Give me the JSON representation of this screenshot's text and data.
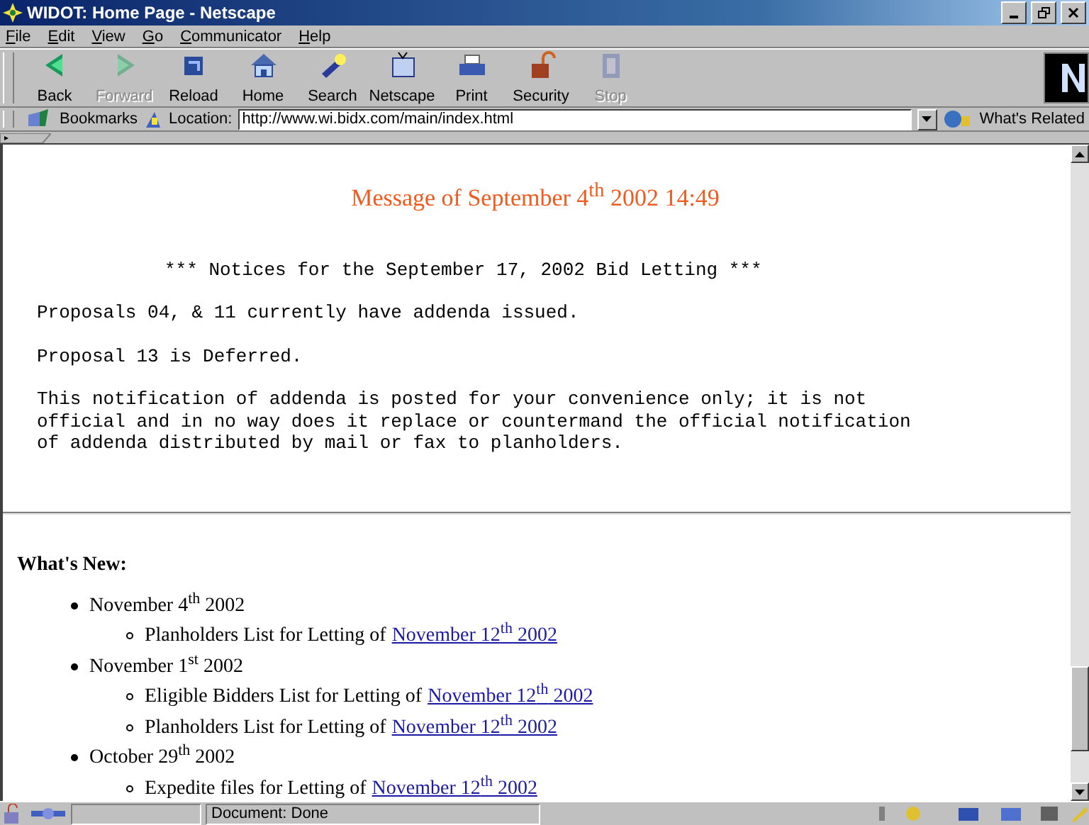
{
  "window": {
    "title": "WIDOT: Home Page - Netscape"
  },
  "menu": [
    "File",
    "Edit",
    "View",
    "Go",
    "Communicator",
    "Help"
  ],
  "toolbar": [
    {
      "kind": "back",
      "label": "Back",
      "disabled": false
    },
    {
      "kind": "forward",
      "label": "Forward",
      "disabled": true
    },
    {
      "kind": "reload",
      "label": "Reload",
      "disabled": false
    },
    {
      "kind": "home",
      "label": "Home",
      "disabled": false
    },
    {
      "kind": "search",
      "label": "Search",
      "disabled": false
    },
    {
      "kind": "netscape",
      "label": "Netscape",
      "disabled": false
    },
    {
      "kind": "print",
      "label": "Print",
      "disabled": false
    },
    {
      "kind": "security",
      "label": "Security",
      "disabled": false
    },
    {
      "kind": "stop",
      "label": "Stop",
      "disabled": true
    }
  ],
  "location_bar": {
    "bookmarks": "Bookmarks",
    "label": "Location:",
    "url": "http://www.wi.bidx.com/main/index.html",
    "related": "What's Related"
  },
  "page": {
    "heading": "Message of September 4$^{th}$ 2002 14:49",
    "notice_blocks": [
      {
        "kind": "indented",
        "text": "*** Notices for the September 17, 2002 Bid Letting ***"
      },
      {
        "kind": "plain",
        "text": "Proposals 04, & 11 currently have addenda issued."
      },
      {
        "kind": "plain",
        "text": "Proposal 13 is Deferred."
      },
      {
        "kind": "plain",
        "text": "This notification of addenda is posted for your convenience only; it is not\nofficial and in no way does it replace or countermand the official notification\nof addenda distributed by mail or fax to planholders."
      }
    ],
    "whats_new_title": "What's New:",
    "whats_new": [
      {
        "text": "November 4$^{th}$ 2002",
        "children": [
          {
            "text": "Planholders List for Letting of",
            "link": "November 12$^{th}$ 2002"
          }
        ]
      },
      {
        "text": "November 1$^{st}$ 2002",
        "children": [
          {
            "text": "Eligible Bidders List for Letting of",
            "link": "November 12$^{th}$ 2002"
          },
          {
            "text": "Planholders List for Letting of",
            "link": "November 12$^{th}$ 2002"
          }
        ]
      },
      {
        "text": "October 29$^{th}$ 2002",
        "children": [
          {
            "text": "Expedite files for Letting of",
            "link": "November 12$^{th}$ 2002"
          }
        ]
      }
    ]
  },
  "status_bar": {
    "text": "Document: Done"
  }
}
